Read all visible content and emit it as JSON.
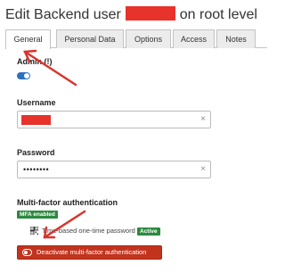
{
  "header": {
    "title_prefix": "Edit Backend user",
    "title_suffix": "on root level"
  },
  "tabs": [
    {
      "label": "General",
      "active": true
    },
    {
      "label": "Personal Data",
      "active": false
    },
    {
      "label": "Options",
      "active": false
    },
    {
      "label": "Access",
      "active": false
    },
    {
      "label": "Notes",
      "active": false
    }
  ],
  "form": {
    "admin_label": "Admin (!)",
    "admin_enabled": true,
    "username_label": "Username",
    "password_label": "Password",
    "password_value": "••••••••",
    "clear_glyph": "×"
  },
  "mfa": {
    "heading": "Multi-factor authentication",
    "enabled_badge": "MFA enabled",
    "provider_text": "Time-based one-time password",
    "provider_status": "Active",
    "deactivate_label": "Deactivate multi-factor authentication"
  },
  "colors": {
    "accent": "#2d6fc2",
    "danger": "#c2331d",
    "success": "#2b8a3e",
    "redaction": "#e8322c",
    "annotation_arrow": "#d9342b"
  },
  "icons": {
    "provider": "qrcode-icon",
    "deactivate": "toggle-off-icon",
    "clear": "close-icon"
  }
}
